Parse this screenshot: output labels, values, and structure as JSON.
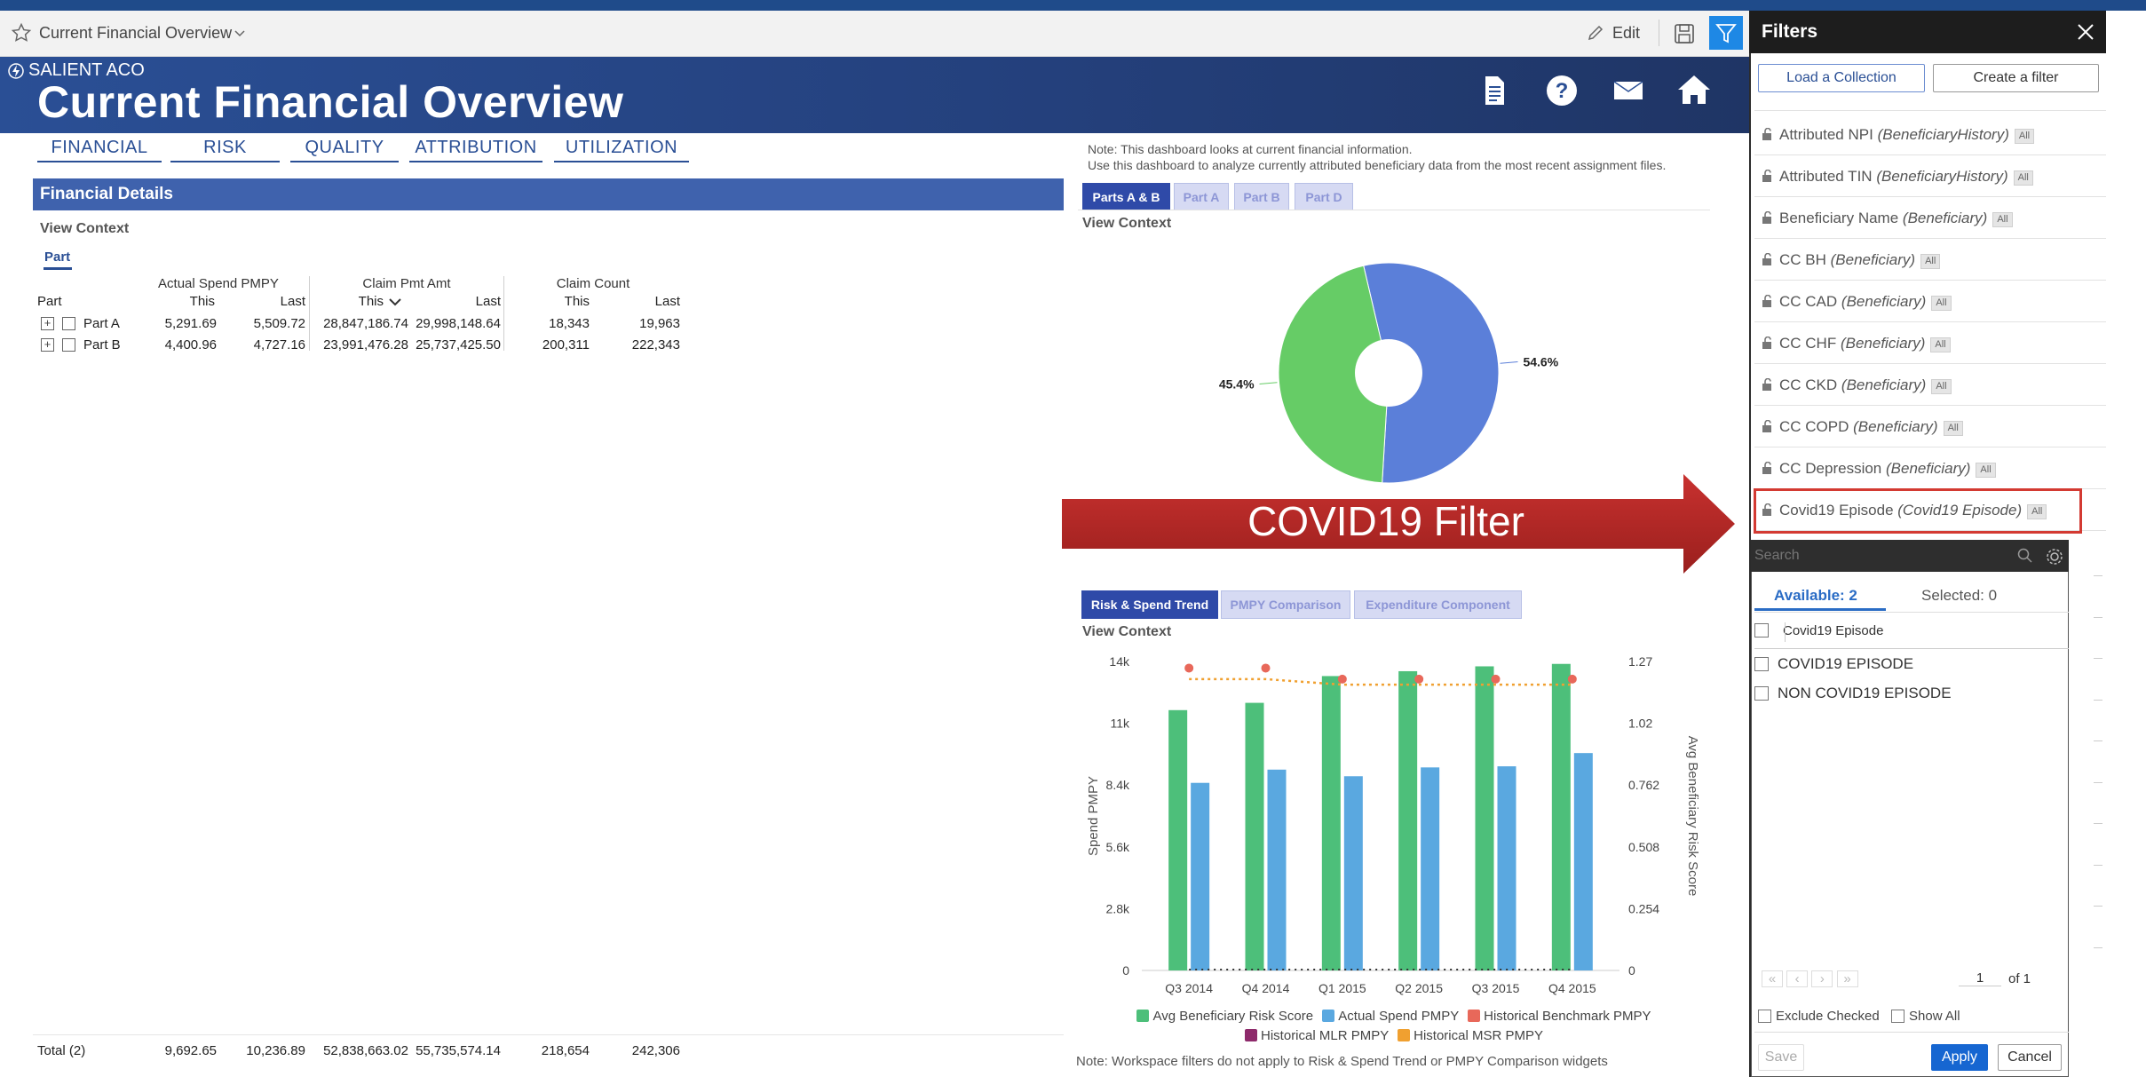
{
  "toolbar": {
    "title": "Current Financial Overview",
    "edit_label": "Edit"
  },
  "banner": {
    "org": "SALIENT ACO",
    "title": "Current Financial Overview"
  },
  "nav": {
    "tabs": [
      "FINANCIAL",
      "RISK",
      "QUALITY",
      "ATTRIBUTION",
      "UTILIZATION"
    ]
  },
  "financial_details": {
    "header": "Financial Details",
    "view_context": "View Context",
    "part_tab": "Part",
    "groups": [
      "Actual Spend PMPY",
      "Claim Pmt Amt",
      "Claim Count"
    ],
    "columns": [
      "Part",
      "This",
      "Last",
      "This",
      "Last",
      "This",
      "Last"
    ],
    "rows": [
      {
        "part": "Part A",
        "spend_this": "5,291.69",
        "spend_last": "5,509.72",
        "pmt_this": "28,847,186.74",
        "pmt_last": "29,998,148.64",
        "count_this": "18,343",
        "count_last": "19,963"
      },
      {
        "part": "Part B",
        "spend_this": "4,400.96",
        "spend_last": "4,727.16",
        "pmt_this": "23,991,476.28",
        "pmt_last": "25,737,425.50",
        "count_this": "200,311",
        "count_last": "222,343"
      }
    ],
    "total": {
      "label": "Total (2)",
      "spend_this": "9,692.65",
      "spend_last": "10,236.89",
      "pmt_this": "52,838,663.02",
      "pmt_last": "55,735,574.14",
      "count_this": "218,654",
      "count_last": "242,306"
    }
  },
  "note_top": {
    "line1": "Note: This dashboard looks at current financial information.",
    "line2": "Use this dashboard to analyze currently attributed beneficiary data from the most recent assignment files."
  },
  "pie_panel": {
    "tabs": [
      "Parts A & B",
      "Part A",
      "Part B",
      "Part D"
    ],
    "view_context": "View Context"
  },
  "annotation": {
    "label": "COVID19 Filter"
  },
  "trend_panel": {
    "tabs": [
      "Risk & Spend Trend",
      "PMPY Comparison",
      "Expenditure Component"
    ],
    "view_context": "View Context",
    "legend": [
      "Avg Beneficiary Risk Score",
      "Actual Spend PMPY",
      "Historical Benchmark PMPY",
      "Historical MLR PMPY",
      "Historical MSR PMPY"
    ],
    "note": "Note: Workspace filters do not apply to Risk & Spend Trend  or PMPY Comparison widgets"
  },
  "chart_data": [
    {
      "type": "pie",
      "labels": [
        "",
        ""
      ],
      "values": [
        54.6,
        45.4
      ],
      "value_labels": [
        "54.6%",
        "45.4%"
      ],
      "colors": [
        "#5b7fd9",
        "#66cc66"
      ]
    },
    {
      "type": "bar",
      "categories": [
        "Q3 2014",
        "Q4 2014",
        "Q1 2015",
        "Q2 2015",
        "Q3 2015",
        "Q4 2015"
      ],
      "ylabel": "Spend PMPY",
      "y2label": "Avg Beneficiary Risk Score",
      "yticks": [
        "0",
        "2.8k",
        "5.6k",
        "8.4k",
        "11k",
        "14k"
      ],
      "y2ticks": [
        "0",
        "0.254",
        "0.508",
        "0.762",
        "1.02",
        "1.27"
      ],
      "ylim": [
        0,
        14000
      ],
      "y2lim": [
        0,
        1.27
      ],
      "series": [
        {
          "name": "Avg Beneficiary Risk Score",
          "color": "#4dbf7a",
          "axis": "right",
          "values": [
            1.07,
            1.1,
            1.21,
            1.23,
            1.25,
            1.26
          ]
        },
        {
          "name": "Actual Spend PMPY",
          "color": "#5aa8e0",
          "axis": "left",
          "values": [
            8500,
            9100,
            8800,
            9200,
            9250,
            9850
          ]
        },
        {
          "name": "Historical Benchmark PMPY",
          "color": "#e8685a",
          "axis": "left",
          "values": [
            13700,
            13700,
            13200,
            13200,
            13200,
            13200
          ]
        },
        {
          "name": "Historical MLR PMPY",
          "color": "#8e2a6b",
          "axis": "left",
          "values": [
            0,
            0,
            0,
            0,
            0,
            0
          ]
        },
        {
          "name": "Historical MSR PMPY",
          "color": "#f0a030",
          "axis": "left",
          "values": [
            13200,
            13200,
            12950,
            12950,
            12950,
            12950
          ]
        }
      ]
    }
  ],
  "filters": {
    "title": "Filters",
    "load_button": "Load a Collection",
    "create_button": "Create a filter",
    "items": [
      {
        "name": "Attributed NPI",
        "source": "(BeneficiaryHistory)",
        "tag": "All"
      },
      {
        "name": "Attributed TIN",
        "source": "(BeneficiaryHistory)",
        "tag": "All"
      },
      {
        "name": "Beneficiary Name",
        "source": "(Beneficiary)",
        "tag": "All"
      },
      {
        "name": "CC BH",
        "source": "(Beneficiary)",
        "tag": "All"
      },
      {
        "name": "CC CAD",
        "source": "(Beneficiary)",
        "tag": "All"
      },
      {
        "name": "CC CHF",
        "source": "(Beneficiary)",
        "tag": "All"
      },
      {
        "name": "CC CKD",
        "source": "(Beneficiary)",
        "tag": "All"
      },
      {
        "name": "CC COPD",
        "source": "(Beneficiary)",
        "tag": "All"
      },
      {
        "name": "CC Depression",
        "source": "(Beneficiary)",
        "tag": "All"
      },
      {
        "name": "Covid19 Episode",
        "source": "(Covid19 Episode)",
        "tag": "All"
      }
    ]
  },
  "dropdown": {
    "search_placeholder": "Search",
    "available": "Available: 2",
    "selected": "Selected: 0",
    "column_header": "Covid19 Episode",
    "options": [
      "COVID19 EPISODE",
      "NON COVID19 EPISODE"
    ],
    "page_value": "1",
    "page_of": "of 1",
    "exclude_checked": "Exclude Checked",
    "show_all": "Show All",
    "save": "Save",
    "apply": "Apply",
    "cancel": "Cancel"
  }
}
